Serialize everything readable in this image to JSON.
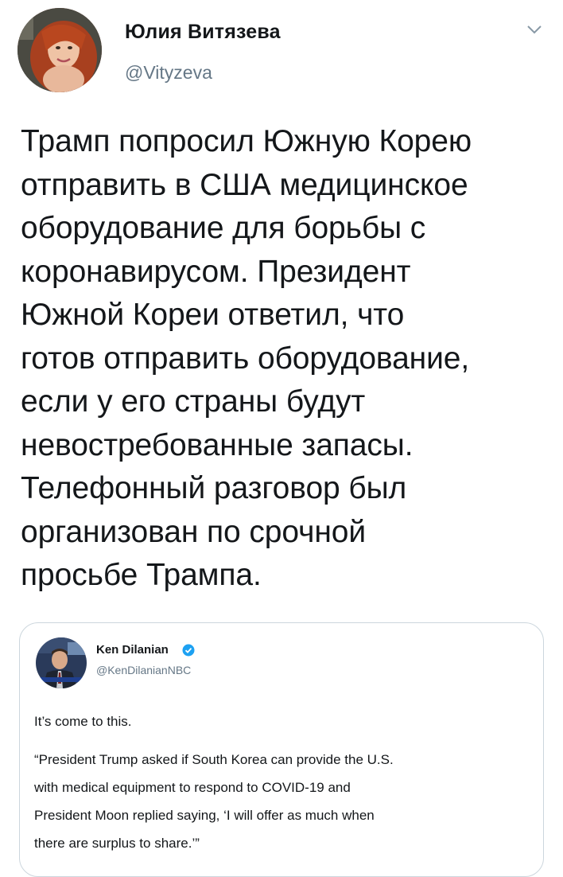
{
  "tweet": {
    "author_name": "Юлия Витязева",
    "author_handle": "@Vityzeva",
    "text": "Трамп попросил Южную Корею\nотправить в США медицинское\nоборудование для борьбы с\nкоронавирусом. Президент\nЮжной Кореи ответил, что\nготов отправить оборудование,\nесли у его страны будут\nневостребованные запасы.\nТелефонный разговор был\nорганизован по срочной\nпросьбе Трампа.",
    "menu_icon": "chevron-down-icon"
  },
  "quoted": {
    "author_name": "Ken Dilanian",
    "author_handle": "@KenDilanianNBC",
    "verified_icon": "verified-badge-icon",
    "text_line1": "It’s come to this.",
    "text_body": "“President Trump asked if South Korea can provide the U.S.\nwith medical equipment to respond to COVID-19 and\nPresident Moon replied saying, ‘I will offer as much when\nthere are surplus to share.’”"
  },
  "colors": {
    "text": "#14171a",
    "secondary": "#657786",
    "border": "#ccd6dd",
    "verified": "#1da1f2"
  }
}
